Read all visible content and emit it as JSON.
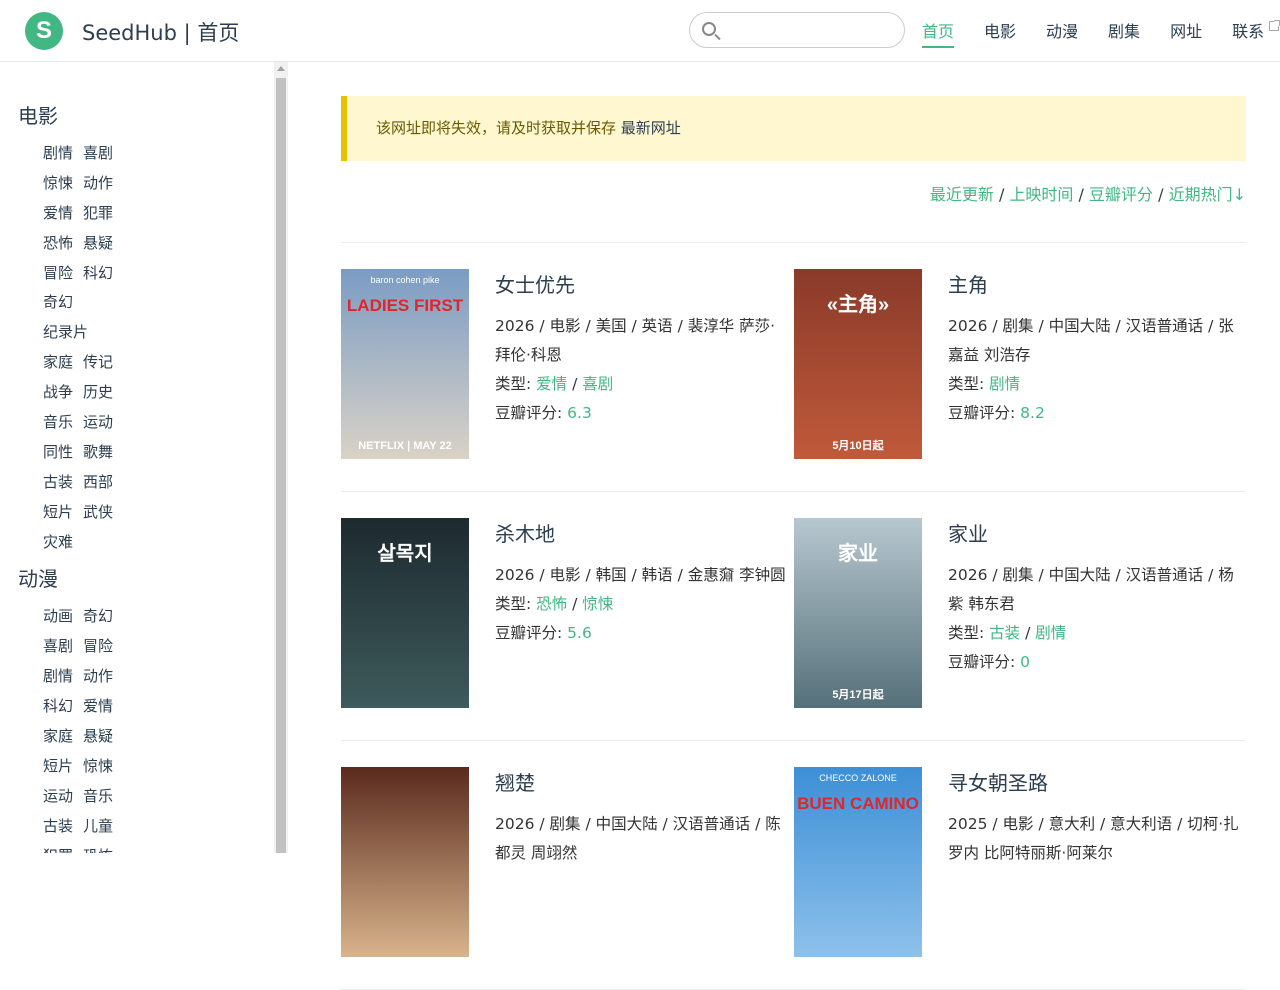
{
  "header": {
    "logo_letter": "S",
    "site_title": "SeedHub | 首页",
    "search_placeholder": "",
    "nav": [
      "首页",
      "电影",
      "动漫",
      "剧集",
      "网址",
      "联系"
    ]
  },
  "sidebar": {
    "movies": {
      "heading": "电影",
      "rows": [
        [
          "剧情",
          "喜剧"
        ],
        [
          "惊悚",
          "动作"
        ],
        [
          "爱情",
          "犯罪"
        ],
        [
          "恐怖",
          "悬疑"
        ],
        [
          "冒险",
          "科幻"
        ],
        [
          "奇幻"
        ],
        [
          "纪录片"
        ],
        [
          "家庭",
          "传记"
        ],
        [
          "战争",
          "历史"
        ],
        [
          "音乐",
          "运动"
        ],
        [
          "同性",
          "歌舞"
        ],
        [
          "古装",
          "西部"
        ],
        [
          "短片",
          "武侠"
        ],
        [
          "灾难"
        ]
      ]
    },
    "anime": {
      "heading": "动漫",
      "rows": [
        [
          "动画",
          "奇幻"
        ],
        [
          "喜剧",
          "冒险"
        ],
        [
          "剧情",
          "动作"
        ],
        [
          "科幻",
          "爱情"
        ],
        [
          "家庭",
          "悬疑"
        ],
        [
          "短片",
          "惊悚"
        ],
        [
          "运动",
          "音乐"
        ],
        [
          "古装",
          "儿童"
        ],
        [
          "犯罪",
          "恐怖"
        ]
      ]
    }
  },
  "notice": {
    "text": "该网址即将失效，请及时获取并保存 ",
    "link": "最新网址"
  },
  "sort": {
    "options": [
      "最近更新",
      "上映时间",
      "豆瓣评分",
      "近期热门↓"
    ],
    "separator": " / "
  },
  "labels": {
    "type": "类型: ",
    "rating": "豆瓣评分: "
  },
  "items": [
    {
      "title": "女士优先",
      "meta": "2026 / 电影 / 美国 / 英语 / 裴淳华 萨莎·拜伦·科恩",
      "genres": [
        "爱情",
        "喜剧"
      ],
      "rating": "6.3",
      "poster_text": "LADIES FIRST",
      "poster_sub": "baron cohen   pike",
      "poster_date": "NETFLIX | MAY 22",
      "poster_colors": [
        "#7b9cc4",
        "#d9d2c6"
      ]
    },
    {
      "title": "主角",
      "meta": "2026 / 剧集 / 中国大陆 / 汉语普通话 / 张嘉益 刘浩存",
      "genres": [
        "剧情"
      ],
      "rating": "8.2",
      "poster_text": "«主角»",
      "poster_sub": "",
      "poster_date": "5月10日起",
      "poster_colors": [
        "#8a3a2a",
        "#c05a3a"
      ]
    },
    {
      "title": "杀木地",
      "meta": "2026 / 电影 / 韩国 / 韩语 / 金惠奫 李钟圆",
      "genres": [
        "恐怖",
        "惊悚"
      ],
      "rating": "5.6",
      "poster_text": "살목지",
      "poster_sub": "",
      "poster_date": "",
      "poster_colors": [
        "#1d2a2e",
        "#3e5a5c"
      ]
    },
    {
      "title": "家业",
      "meta": "2026 / 剧集 / 中国大陆 / 汉语普通话 / 杨紫 韩东君",
      "genres": [
        "古装",
        "剧情"
      ],
      "rating": "0",
      "poster_text": "家业",
      "poster_sub": "",
      "poster_date": "5月17日起",
      "poster_colors": [
        "#b7c7cf",
        "#55707a"
      ]
    },
    {
      "title": "翘楚",
      "meta": "2026 / 剧集 / 中国大陆 / 汉语普通话 / 陈都灵 周翊然",
      "genres": [],
      "rating": "",
      "poster_text": "",
      "poster_sub": "",
      "poster_date": "",
      "poster_colors": [
        "#5a2a1e",
        "#d8b48c"
      ]
    },
    {
      "title": "寻女朝圣路",
      "meta": "2025 / 电影 / 意大利 / 意大利语 / 切柯·扎罗内 比阿特丽斯·阿莱尔",
      "genres": [],
      "rating": "",
      "poster_text": "BUEN CAMINO",
      "poster_sub": "CHECCO ZALONE",
      "poster_date": "",
      "poster_colors": [
        "#3d8fd6",
        "#8dc1ea"
      ]
    }
  ]
}
